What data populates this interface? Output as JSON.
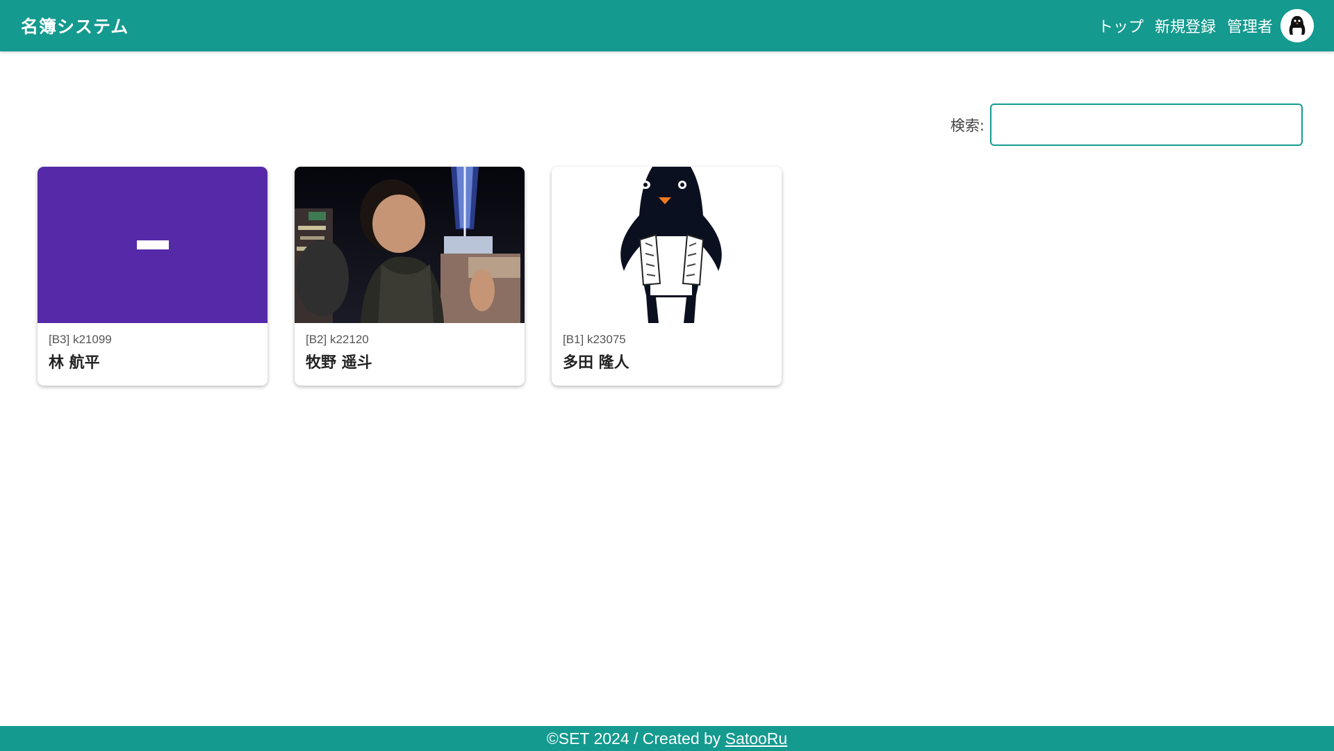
{
  "header": {
    "brand": "名簿システム",
    "nav": [
      "トップ",
      "新規登録",
      "管理者"
    ]
  },
  "search": {
    "label": "検索:",
    "value": "",
    "placeholder": ""
  },
  "cards": [
    {
      "meta": "[B3] k21099",
      "name": "林 航平",
      "image": "purple-placeholder"
    },
    {
      "meta": "[B2] k22120",
      "name": "牧野 遥斗",
      "image": "photo"
    },
    {
      "meta": "[B1] k23075",
      "name": "多田 隆人",
      "image": "penguin-illustration"
    }
  ],
  "footer": {
    "text": "©SET 2024 / Created by ",
    "link": "SatooRu"
  },
  "colors": {
    "primary": "#149a8f",
    "placeholder_purple": "#5529a8"
  }
}
